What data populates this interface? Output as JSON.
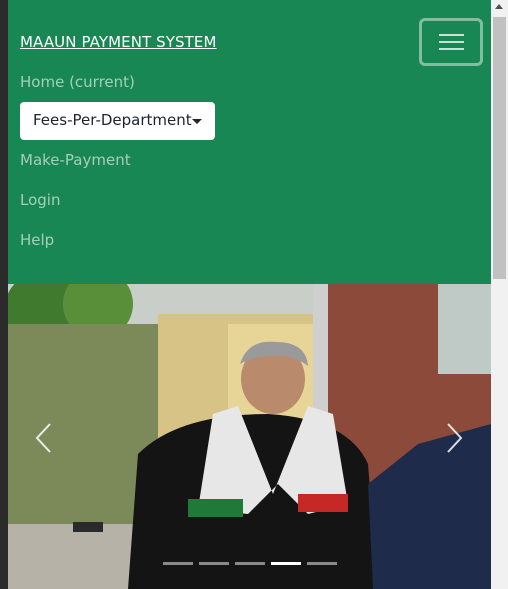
{
  "navbar": {
    "brand": "MAAUN PAYMENT SYSTEM",
    "toggler_icon": "hamburger-icon",
    "links": {
      "home": "Home (current)",
      "make_payment": "Make-Payment",
      "login": "Login",
      "help": "Help"
    },
    "dropdown_label": "Fees-Per-Department",
    "colors": {
      "background": "#198754",
      "link": "rgba(255,255,255,0.6)",
      "brand": "#ffffff"
    }
  },
  "carousel": {
    "prev_icon": "chevron-left-icon",
    "next_icon": "chevron-right-icon",
    "slide_count": 5,
    "active_slide": 4
  },
  "scrollbar": {
    "up_icon": "arrow-up-icon"
  }
}
